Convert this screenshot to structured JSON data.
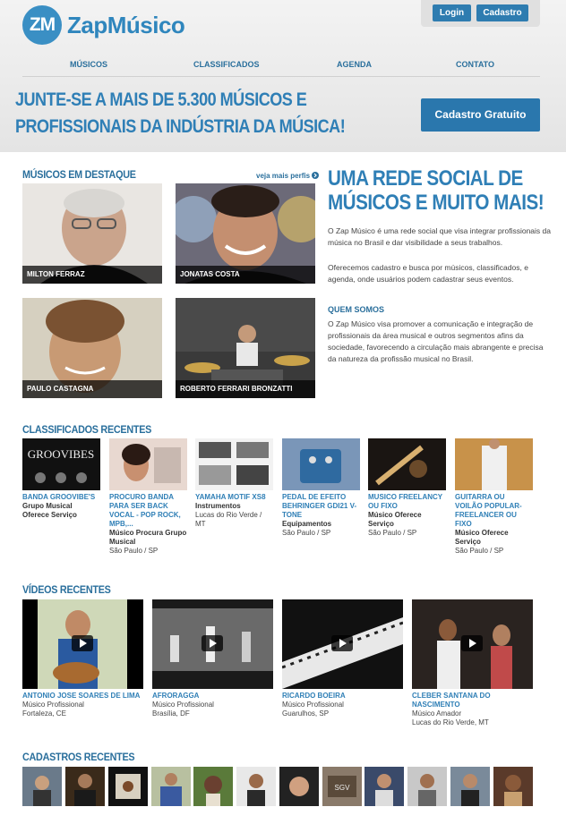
{
  "brand": {
    "logo_mark": "ZM",
    "name": "ZapMúsico"
  },
  "auth": {
    "login": "Login",
    "signup": "Cadastro"
  },
  "nav": [
    "MÚSICOS",
    "CLASSIFICADOS",
    "AGENDA",
    "CONTATO"
  ],
  "hero": {
    "headline_line1": "JUNTE-SE A MAIS DE 5.300 MÚSICOS E",
    "headline_line2": "PROFISSIONAIS DA INDÚSTRIA DA MÚSICA!",
    "cta": "Cadastro Gratuito"
  },
  "featured": {
    "title": "MÚSICOS EM DESTAQUE",
    "more_link": "veja mais perfis",
    "items": [
      {
        "name": "MILTON FERRAZ"
      },
      {
        "name": "JONATAS COSTA"
      },
      {
        "name": "PAULO CASTAGNA"
      },
      {
        "name": "ROBERTO FERRARI BRONZATTI"
      }
    ]
  },
  "about": {
    "title_line1": "UMA REDE SOCIAL DE",
    "title_line2": "MÚSICOS E MUITO MAIS!",
    "p1": "O Zap Músico é uma rede social que visa integrar profissionais da música no Brasil e dar visibilidade a seus trabalhos.",
    "p2": "Oferecemos cadastro e busca por músicos, classificados, e agenda, onde usuários podem cadastrar seus eventos.",
    "subtitle": "QUEM SOMOS",
    "p3": "O Zap Músico visa promover a comunicação e integração de profissionais da área musical e outros segmentos afins da sociedade, favorecendo a circulação mais abrangente e precisa da natureza da profissão musical no Brasil."
  },
  "classifieds": {
    "title": "CLASSIFICADOS RECENTES",
    "items": [
      {
        "title": "BANDA GROOVIBE'S",
        "subtitle": "Grupo Musical Oferece Serviço",
        "location": ""
      },
      {
        "title": "PROCURO BANDA PARA SER BACK VOCAL - POP ROCK, MPB,...",
        "subtitle": "Músico Procura Grupo Musical",
        "location": "São Paulo / SP"
      },
      {
        "title": "YAMAHA MOTIF XS8",
        "subtitle": "Instrumentos",
        "location": "Lucas do Rio Verde / MT"
      },
      {
        "title": "PEDAL DE EFEITO BEHRINGER GDI21 V-TONE",
        "subtitle": "Equipamentos",
        "location": "São Paulo / SP"
      },
      {
        "title": "MUSICO FREELANCY OU FIXO",
        "subtitle": "Músico Oferece Serviço",
        "location": "São Paulo / SP"
      },
      {
        "title": "GUITARRA OU VOILÃO POPULAR-FREELANCER OU FIXO",
        "subtitle": "Músico Oferece Serviço",
        "location": "São Paulo / SP"
      }
    ]
  },
  "videos": {
    "title": "VÍDEOS RECENTES",
    "items": [
      {
        "title": "ANTONIO JOSE SOARES DE LIMA",
        "subtitle": "Músico Profissional",
        "location": "Fortaleza, CE"
      },
      {
        "title": "AFRORAGGA",
        "subtitle": "Músico Profissional",
        "location": "Brasília, DF"
      },
      {
        "title": "RICARDO BOEIRA",
        "subtitle": "Músico Profissional",
        "location": "Guarulhos, SP"
      },
      {
        "title": "CLEBER SANTANA DO NASCIMENTO",
        "subtitle": "Músico Amador",
        "location": "Lucas do Rio Verde, MT"
      }
    ]
  },
  "recent_signups": {
    "title": "CADASTROS RECENTES"
  },
  "colors": {
    "brand_blue": "#2f7fb6",
    "button_blue": "#2a77ad"
  }
}
